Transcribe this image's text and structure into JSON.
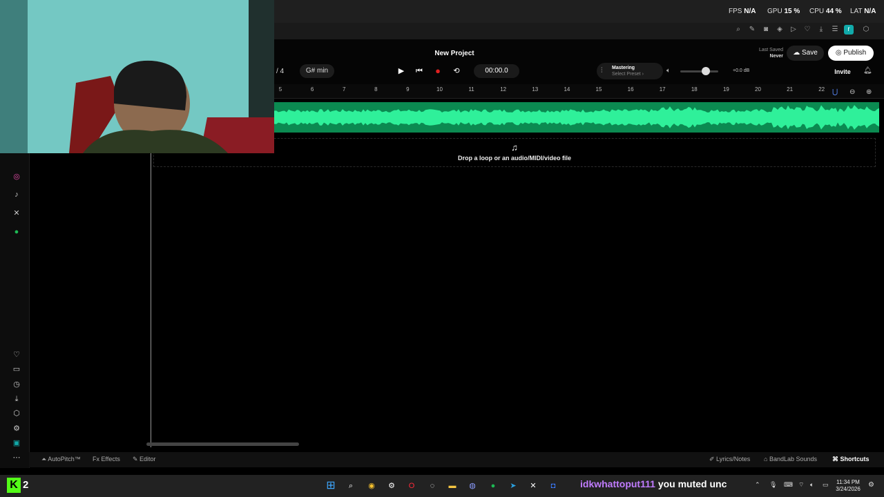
{
  "stats": {
    "fps_label": "FPS",
    "fps_value": "N/A",
    "gpu_label": "GPU",
    "gpu_value": "15 %",
    "cpu_label": "CPU",
    "cpu_value": "44 %",
    "lat_label": "LAT",
    "lat_value": "N/A"
  },
  "header": {
    "project_title": "New Project",
    "time_sig_tail": "/ 4",
    "key": "G# min",
    "time": "00:00.0",
    "mastering_title": "Mastering",
    "mastering_sub": "Select Preset ›",
    "volume_db": "+0.0 dB",
    "last_saved_label": "Last Saved",
    "last_saved_value": "Never",
    "save_label": "Save",
    "publish_label": "Publish",
    "invite_label": "Invite"
  },
  "ruler": {
    "ticks": [
      "5",
      "6",
      "7",
      "8",
      "9",
      "10",
      "11",
      "12",
      "13",
      "14",
      "15",
      "16",
      "17",
      "18",
      "19",
      "20",
      "21",
      "22"
    ]
  },
  "drop_zone": {
    "text": "Drop a loop or an audio/MIDI/video file"
  },
  "bottom_bar": {
    "autopitch": "AutoPitch™",
    "effects": "Effects",
    "editor": "Editor",
    "lyrics": "Lyrics/Notes",
    "bandlab": "BandLab Sounds",
    "shortcuts": "Shortcuts"
  },
  "taskbar": {
    "kick_count": "2",
    "chat_user": "idkwhattoput111",
    "chat_message": "you muted unc",
    "time": "11:34 PM",
    "date": "3/24/2026"
  },
  "colors": {
    "accent_green": "#0e9c5c",
    "record_red": "#e02020",
    "chat_purple": "#c17cff"
  }
}
